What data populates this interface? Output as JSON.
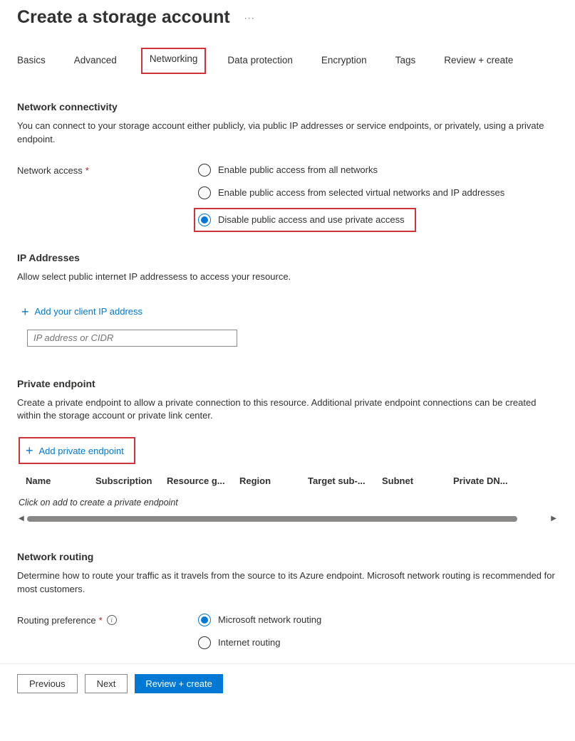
{
  "header": {
    "title": "Create a storage account",
    "ellipsis": "···"
  },
  "tabs": {
    "basics": "Basics",
    "advanced": "Advanced",
    "networking": "Networking",
    "data_protection": "Data protection",
    "encryption": "Encryption",
    "tags": "Tags",
    "review": "Review + create"
  },
  "network_connectivity": {
    "title": "Network connectivity",
    "desc": "You can connect to your storage account either publicly, via public IP addresses or service endpoints, or privately, using a private endpoint.",
    "label": "Network access",
    "options": {
      "public_all": "Enable public access from all networks",
      "public_selected": "Enable public access from selected virtual networks and IP addresses",
      "private": "Disable public access and use private access"
    },
    "selected": "private"
  },
  "ip_addresses": {
    "title": "IP Addresses",
    "desc": "Allow select public internet IP addressess to access your resource.",
    "add_label": "Add your client IP address",
    "input_placeholder": "IP address or CIDR"
  },
  "private_endpoint": {
    "title": "Private endpoint",
    "desc": "Create a private endpoint to allow a private connection to this resource. Additional private endpoint connections can be created within the storage account or private link center.",
    "add_label": "Add private endpoint",
    "columns": {
      "name": "Name",
      "subscription": "Subscription",
      "resource_group": "Resource g...",
      "region": "Region",
      "target": "Target sub-...",
      "subnet": "Subnet",
      "dns": "Private DN..."
    },
    "empty": "Click on add to create a private endpoint"
  },
  "network_routing": {
    "title": "Network routing",
    "desc": "Determine how to route your traffic as it travels from the source to its Azure endpoint. Microsoft network routing is recommended for most customers.",
    "label": "Routing preference",
    "options": {
      "microsoft": "Microsoft network routing",
      "internet": "Internet routing"
    },
    "selected": "microsoft"
  },
  "footer": {
    "previous": "Previous",
    "next": "Next",
    "review": "Review + create"
  },
  "icons": {
    "required": "*",
    "info": "i",
    "plus": "+",
    "scroll_left": "◀",
    "scroll_right": "▶"
  }
}
